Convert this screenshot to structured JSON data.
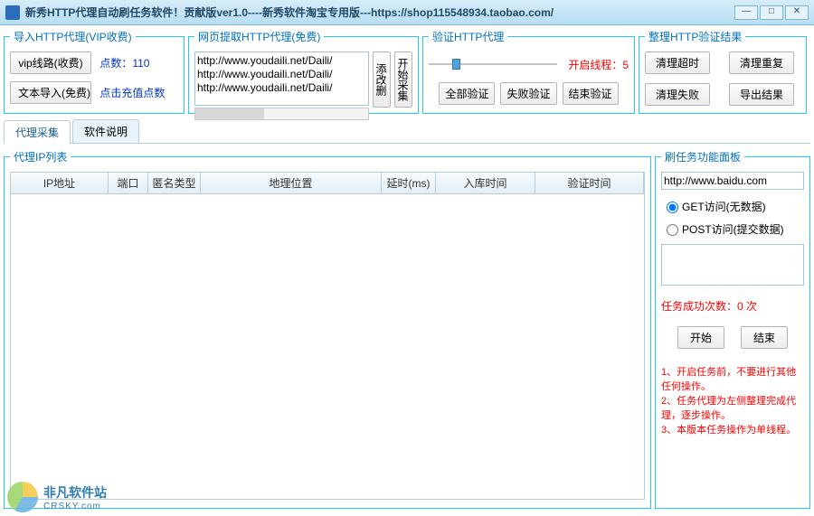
{
  "title": "新秀HTTP代理自动刷任务软件！贡献版ver1.0----新秀软件淘宝专用版---https://shop115548934.taobao.com/",
  "groups": {
    "import": {
      "legend": "导入HTTP代理(VIP收费)",
      "vip_btn": "vip线路(收费)",
      "points_label": "点数：110",
      "text_import_btn": "文本导入(免费)",
      "recharge_label": "点击充值点数"
    },
    "web": {
      "legend": "网页提取HTTP代理(免费)",
      "urls": [
        "http://www.youdaili.net/Daili/",
        "http://www.youdaili.net/Daili/",
        "http://www.youdaili.net/Daili/"
      ],
      "edit_btn": "添改删",
      "start_btn": "开始采集"
    },
    "verify": {
      "legend": "验证HTTP代理",
      "thread_label": "开启线程：5",
      "all_btn": "全部验证",
      "fail_btn": "失败验证",
      "end_btn": "结束验证"
    },
    "clean": {
      "legend": "整理HTTP验证结果",
      "timeout_btn": "清理超时",
      "dup_btn": "清理重复",
      "fail_btn": "清理失败",
      "export_btn": "导出结果"
    }
  },
  "tabs": {
    "collect": "代理采集",
    "doc": "软件说明"
  },
  "iplist": {
    "legend": "代理IP列表",
    "cols": {
      "ip": "IP地址",
      "port": "端口",
      "anon": "匿名类型",
      "geo": "地理位置",
      "delay": "延时(ms)",
      "intime": "入库时间",
      "vtime": "验证时间"
    }
  },
  "task": {
    "legend": "刷任务功能面板",
    "url": "http://www.baidu.com",
    "get_label": "GET访问(无数据)",
    "post_label": "POST访问(提交数据)",
    "success_label": "任务成功次数：0 次",
    "start_btn": "开始",
    "end_btn": "结束",
    "tips": "1、开启任务前，不要进行其他任何操作。\n2、任务代理为左侧整理完成代理，逐步操作。\n3、本版本任务操作为单线程。"
  },
  "watermark": {
    "name": "非凡软件站",
    "domain": "CRSKY.com"
  }
}
